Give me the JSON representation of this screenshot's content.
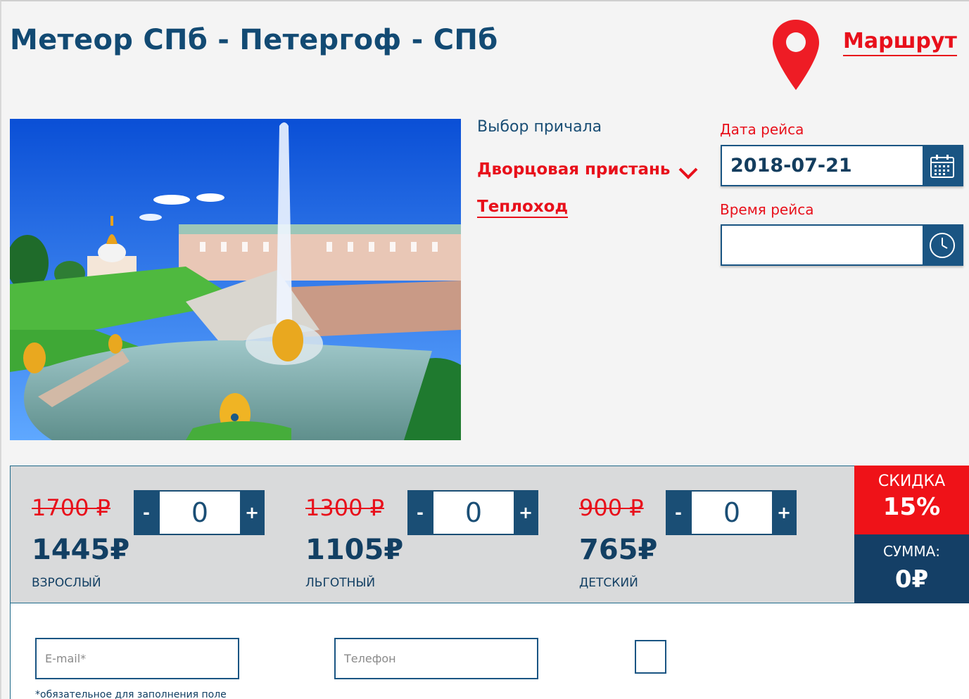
{
  "header": {
    "title": "Метеор СПб - Петергоф - СПб",
    "route_link": "Маршрут"
  },
  "booking": {
    "pier_label": "Выбор причала",
    "pier_value": "Дворцовая пристань",
    "vessel_link": "Теплоход",
    "date_label": "Дата рейса",
    "date_value": "2018-07-21",
    "time_label": "Время рейса",
    "time_value": ""
  },
  "tickets": [
    {
      "old_price": "1700 ₽",
      "new_price": "1445₽",
      "label": "ВЗРОСЛЫЙ",
      "quantity": "0",
      "minus": "-",
      "plus": "+"
    },
    {
      "old_price": "1300 ₽",
      "new_price": "1105₽",
      "label": "ЛЬГОТНЫЙ",
      "quantity": "0",
      "minus": "-",
      "plus": "+"
    },
    {
      "old_price": "900 ₽",
      "new_price": "765₽",
      "label": "ДЕТСКИЙ",
      "quantity": "0",
      "minus": "-",
      "plus": "+"
    }
  ],
  "summary": {
    "discount_label": "СКИДКА",
    "discount_value": "15%",
    "total_label": "СУММА:",
    "total_value": "0₽"
  },
  "form": {
    "email_placeholder": "E-mail*",
    "phone_placeholder": "Телефон",
    "required_note": "*обязательное для заполнения поле"
  },
  "colors": {
    "accent_red": "#e8101b",
    "navy": "#1a4e75",
    "band_gray": "#d9dadb"
  },
  "icons": [
    "map-pin-icon",
    "chevron-down-icon",
    "calendar-icon",
    "clock-icon"
  ]
}
